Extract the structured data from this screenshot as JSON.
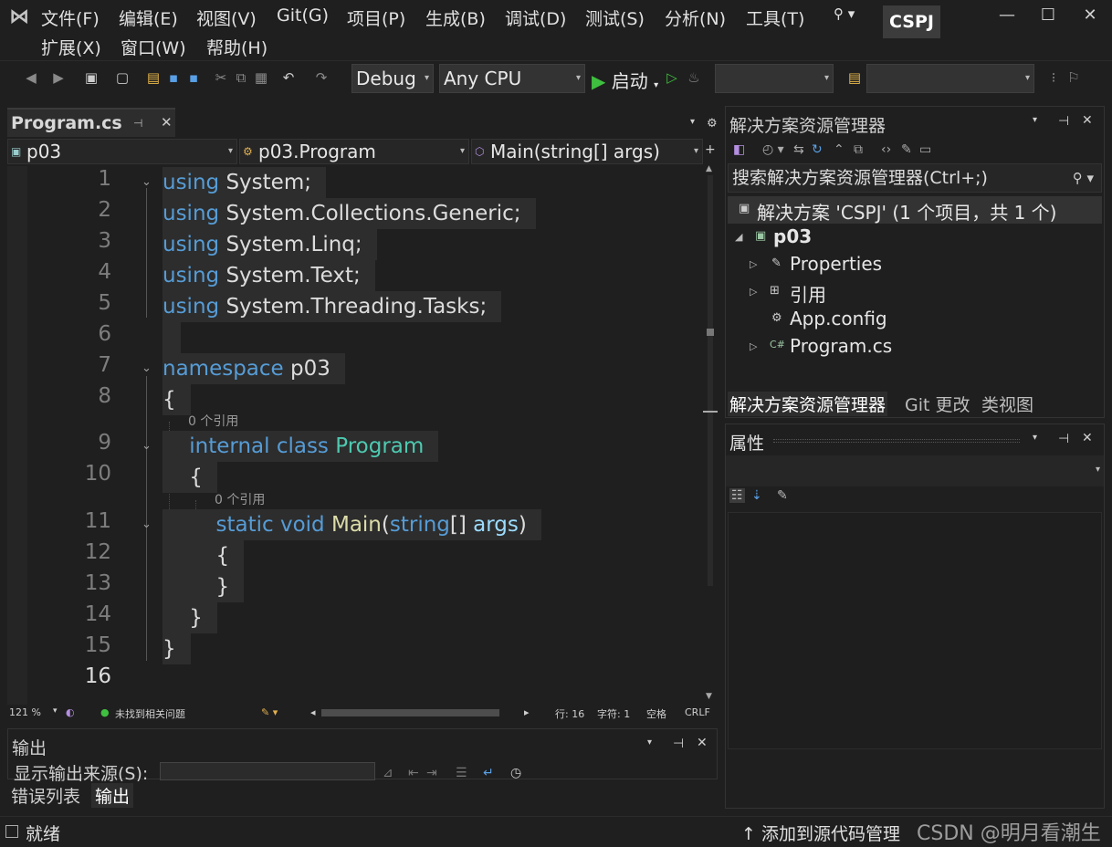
{
  "menu": {
    "items": [
      "文件(F)",
      "编辑(E)",
      "视图(V)",
      "Git(G)",
      "项目(P)",
      "生成(B)",
      "调试(D)",
      "测试(S)",
      "分析(N)",
      "工具(T)"
    ],
    "row2": [
      "扩展(X)",
      "窗口(W)",
      "帮助(H)"
    ],
    "project_name": "CSPJ"
  },
  "toolbar": {
    "config": "Debug",
    "platform": "Any CPU",
    "start_label": "启动"
  },
  "editor": {
    "tab_title": "Program.cs",
    "nav": {
      "project": "p03",
      "type": "p03.Program",
      "member": "Main(string[] args)"
    },
    "lines": [
      {
        "n": "1",
        "text": "using System;"
      },
      {
        "n": "2",
        "text": "using System.Collections.Generic;"
      },
      {
        "n": "3",
        "text": "using System.Linq;"
      },
      {
        "n": "4",
        "text": "using System.Text;"
      },
      {
        "n": "5",
        "text": "using System.Threading.Tasks;"
      },
      {
        "n": "6",
        "text": ""
      },
      {
        "n": "7",
        "text": "namespace p03"
      },
      {
        "n": "8",
        "text": "{"
      },
      {
        "n": "9",
        "text": "internal class Program"
      },
      {
        "n": "10",
        "text": "{"
      },
      {
        "n": "11",
        "text": "static void Main(string[] args)"
      },
      {
        "n": "12",
        "text": "{"
      },
      {
        "n": "13",
        "text": "}"
      },
      {
        "n": "14",
        "text": "}"
      },
      {
        "n": "15",
        "text": "}"
      },
      {
        "n": "16",
        "text": ""
      }
    ],
    "ref_hint": "0 个引用",
    "status": {
      "zoom": "121 %",
      "issues": "未找到相关问题",
      "line": "行: 16",
      "char": "字符: 1",
      "whitespace": "空格",
      "eol": "CRLF"
    }
  },
  "output": {
    "title": "输出",
    "source_label": "显示输出来源(S):"
  },
  "bottom_tabs": [
    "错误列表",
    "输出"
  ],
  "solution_explorer": {
    "title": "解决方案资源管理器",
    "search_placeholder": "搜索解决方案资源管理器(Ctrl+;)",
    "solution": "解决方案 'CSPJ' (1 个项目，共 1 个)",
    "project": "p03",
    "items": [
      "Properties",
      "引用",
      "App.config",
      "Program.cs"
    ],
    "tabs": [
      "解决方案资源管理器",
      "Git 更改",
      "类视图"
    ]
  },
  "properties": {
    "title": "属性"
  },
  "statusbar": {
    "ready": "就绪",
    "scm": "↑ 添加到源代码管理",
    "watermark": "CSDN @明月看潮生"
  },
  "colors": {
    "keyword": "#569cd6",
    "class": "#4ec9b0",
    "method": "#dcdcaa",
    "param": "#9cdcfe",
    "background": "#1f1f1f"
  }
}
